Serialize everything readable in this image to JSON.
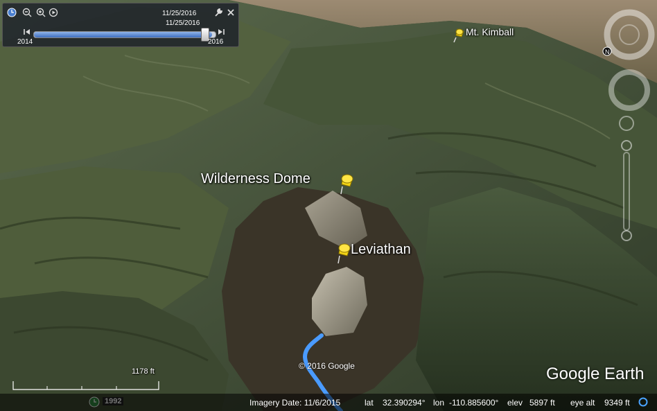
{
  "time_slider": {
    "top_date": "11/25/2016",
    "current_date": "11/25/2016",
    "start_year": "2014",
    "end_year": "2016",
    "position": 0.98
  },
  "placemarks": [
    {
      "label": "Mt. Kimball"
    },
    {
      "label": "Wilderness Dome"
    },
    {
      "label": "Leviathan"
    }
  ],
  "scale_bar": {
    "label": "1178 ft"
  },
  "historical_year": "1992",
  "copyright": "© 2016 Google",
  "logo": "Google Earth",
  "status": {
    "imagery_date": "Imagery Date: 11/6/2015",
    "lat_label": "lat",
    "lat_value": "32.390294°",
    "lon_label": "lon",
    "lon_value": "-110.885600°",
    "elev_label": "elev",
    "elev_value": "5897 ft",
    "eye_alt_label": "eye alt",
    "eye_alt_value": "9349 ft"
  },
  "colors": {
    "pin": "#f2d316",
    "trail": "#4a9bff",
    "panel": "#1e2430"
  }
}
